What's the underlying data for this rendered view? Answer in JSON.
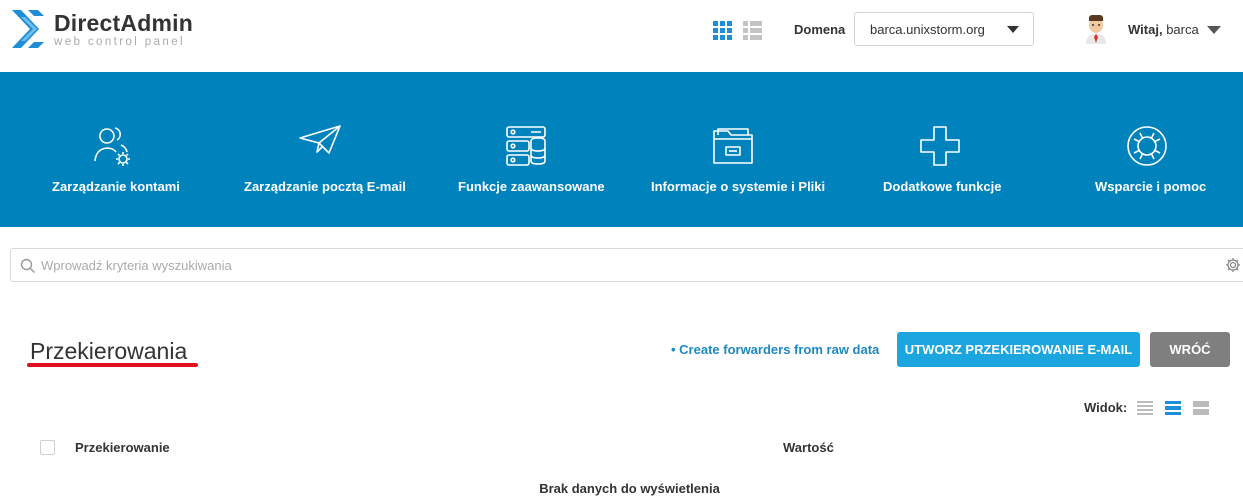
{
  "brand": {
    "title": "DirectAdmin",
    "subtitle": "web control panel"
  },
  "header": {
    "domain_label": "Domena",
    "domain_value": "barca.unixstorm.org",
    "welcome_prefix": "Witaj,",
    "username": "barca"
  },
  "nav": {
    "items": [
      {
        "label": "Zarządzanie kontami",
        "icon": "users-gear-icon"
      },
      {
        "label": "Zarządzanie pocztą E-mail",
        "icon": "paper-plane-icon"
      },
      {
        "label": "Funkcje zaawansowane",
        "icon": "server-database-icon"
      },
      {
        "label": "Informacje o systemie i Pliki",
        "icon": "folder-icon"
      },
      {
        "label": "Dodatkowe funkcje",
        "icon": "plus-icon"
      },
      {
        "label": "Wsparcie i pomoc",
        "icon": "lifebuoy-icon"
      }
    ]
  },
  "search": {
    "placeholder": "Wprowadź kryteria wyszukiwania"
  },
  "page": {
    "title": "Przekierowania",
    "raw_link": "• Create forwarders from raw data",
    "create_button": "UTWORZ PRZEKIEROWANIE E-MAIL",
    "back_button": "WRÓĆ",
    "view_label": "Widok:"
  },
  "table": {
    "columns": [
      "Przekierowanie",
      "Wartość"
    ],
    "empty_text": "Brak danych do wyświetlenia"
  },
  "colors": {
    "nav_bg": "#0083bd",
    "primary_button": "#1ca6df",
    "secondary_button": "#7f7f7f",
    "link": "#1e88c2",
    "title_underline": "#e0101f",
    "logo_blue": "#1e8fd6"
  }
}
